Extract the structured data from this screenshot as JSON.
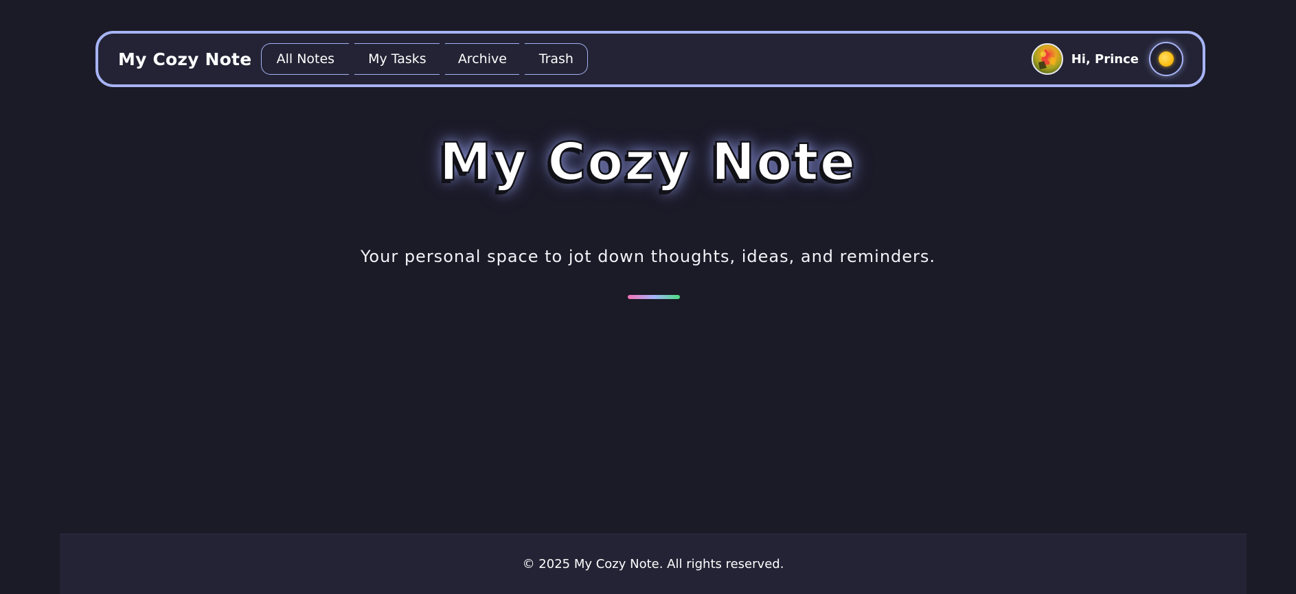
{
  "navbar": {
    "brand": "My Cozy Note",
    "nav_items": [
      {
        "label": "All Notes"
      },
      {
        "label": "My Tasks"
      },
      {
        "label": "Archive"
      },
      {
        "label": "Trash"
      }
    ],
    "greeting": "Hi, Prince",
    "avatar_icon": "user-avatar",
    "theme_toggle_icon": "sun-icon"
  },
  "hero": {
    "title": "My Cozy Note",
    "subtitle": "Your personal space to jot down thoughts, ideas, and reminders."
  },
  "footer": {
    "text": "© 2025 My Cozy Note. All rights reserved."
  },
  "colors": {
    "background": "#1b1a27",
    "panel": "#232335",
    "accent": "#a7b4f5",
    "divider_gradient": [
      "#f472b6",
      "#a5b4fc",
      "#4ade80"
    ]
  }
}
